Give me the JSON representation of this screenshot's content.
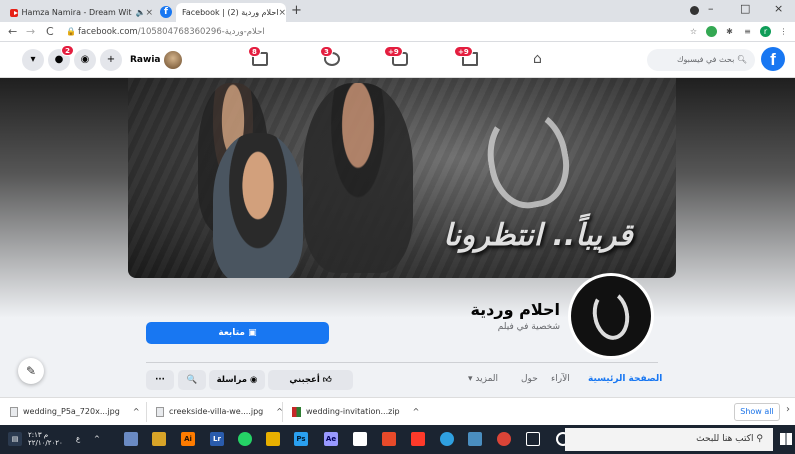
{
  "browser": {
    "tabs": [
      {
        "title": "Hamza Namira - Dream Wit",
        "icon": "youtube-icon",
        "audio": "🔈",
        "close": "×"
      },
      {
        "title": "Facebook | احلام وردية (2)",
        "icon": "facebook-icon",
        "close": "×"
      }
    ],
    "new_tab": "+",
    "window_controls": [
      "–",
      "□",
      "×"
    ],
    "nav": {
      "back": "←",
      "forward": "→",
      "reload": "C"
    },
    "url_domain": "facebook.com",
    "url_path": "/105804768360296-احلام-وردية"
  },
  "fb_header": {
    "logo": "f",
    "search_placeholder": "بحث في فيسبوك",
    "profile_name": "Rawia",
    "notif_badge": "2",
    "nav_badges": [
      "+9",
      "+9",
      "3",
      "8"
    ]
  },
  "cover": {
    "headline": "قريباً.. انتظرونا"
  },
  "page": {
    "name": "احلام وردية",
    "category": "شخصية في فيلم",
    "follow_label": "متابعة",
    "tabs": {
      "home": "الصفحة الرئيسية",
      "reviews": "الآراء",
      "about": "حول",
      "more": "المزيد ▾"
    },
    "actions": {
      "like": "أعجبني",
      "message": "مراسلة",
      "search": "🔍",
      "more": "···"
    }
  },
  "downloads": {
    "items": [
      {
        "name": "wedding_P5a_720x...jpg"
      },
      {
        "name": "creekside-villa-we....jpg"
      },
      {
        "name": "wedding-invitation...zip"
      }
    ],
    "show_all": "Show all",
    "chevron": "^"
  },
  "taskbar": {
    "search_placeholder": "اكتب هنا للبحث",
    "time": "م ٢:١٣",
    "date": "٢٢/١٠/٢٠٢٠",
    "lang": "ع"
  }
}
